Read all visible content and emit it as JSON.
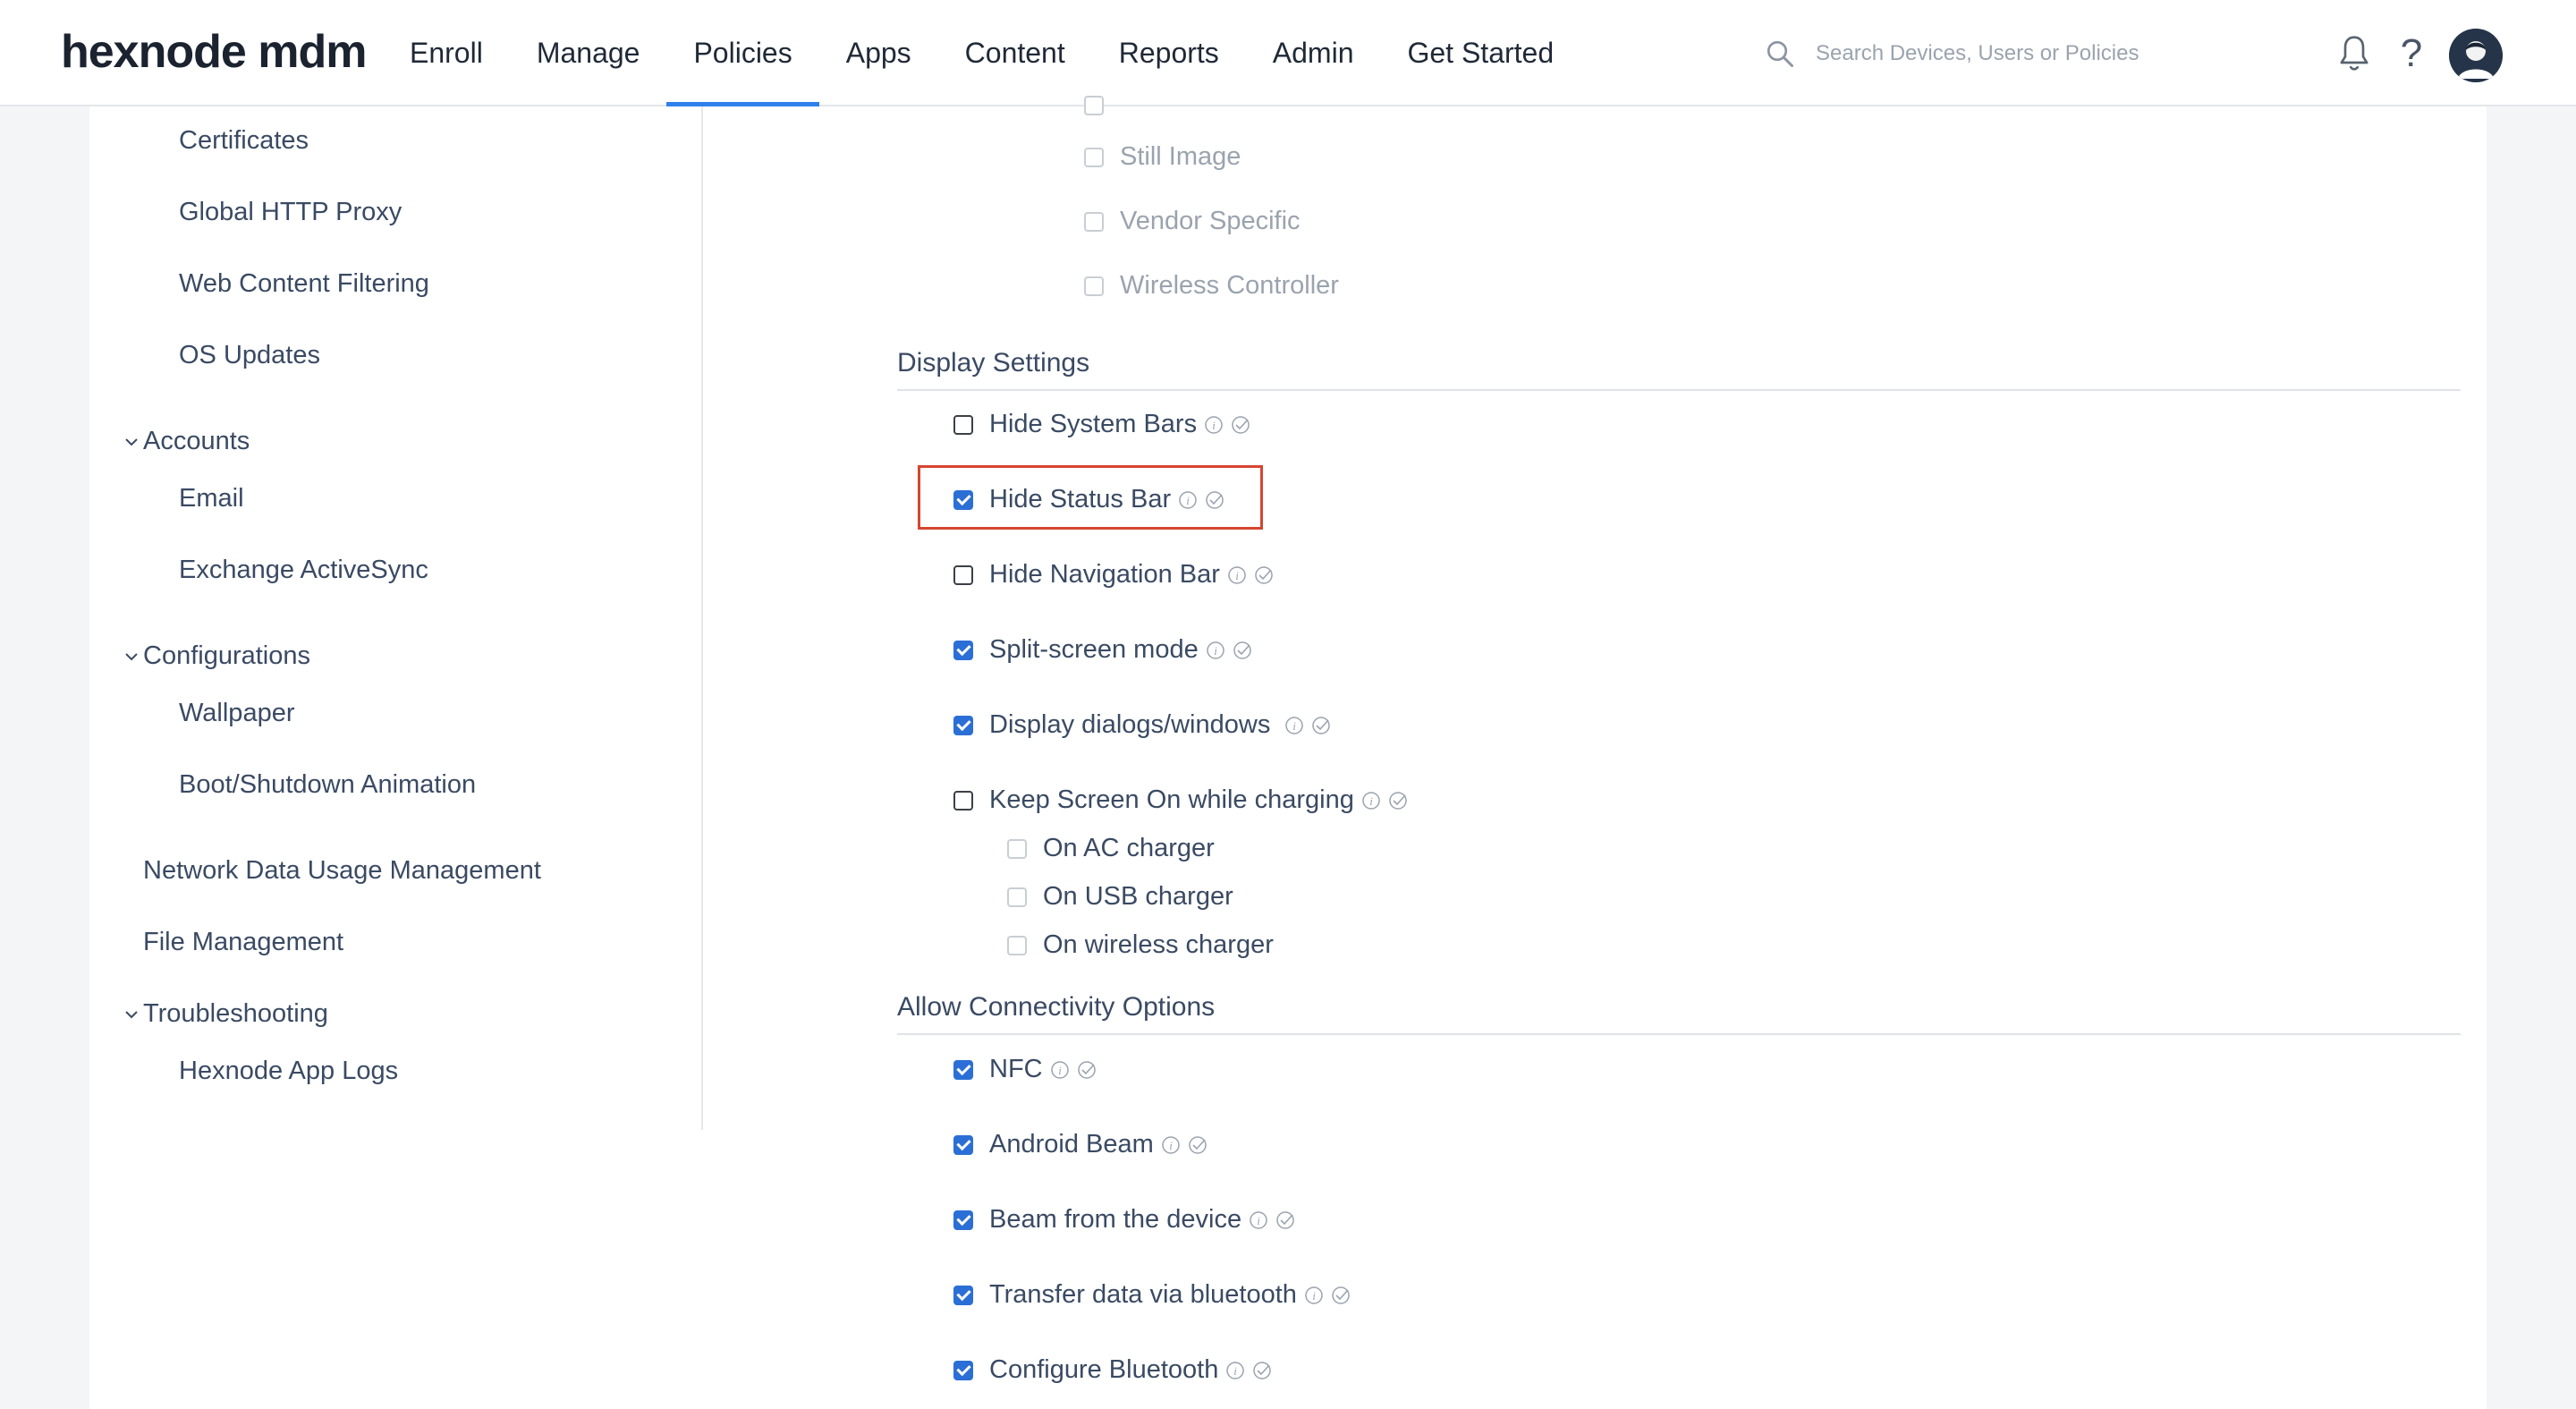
{
  "brand": {
    "logo_text": "hexnode mdm"
  },
  "nav": {
    "items": [
      "Enroll",
      "Manage",
      "Policies",
      "Apps",
      "Content",
      "Reports",
      "Admin",
      "Get Started"
    ],
    "active": "Policies"
  },
  "search": {
    "placeholder": "Search Devices, Users or Policies"
  },
  "sidebar": {
    "items": [
      {
        "label": "Certificates",
        "type": "sub"
      },
      {
        "label": "Global HTTP Proxy",
        "type": "sub"
      },
      {
        "label": "Web Content Filtering",
        "type": "sub"
      },
      {
        "label": "OS Updates",
        "type": "sub"
      },
      {
        "label": "Accounts",
        "type": "group"
      },
      {
        "label": "Email",
        "type": "sub"
      },
      {
        "label": "Exchange ActiveSync",
        "type": "sub"
      },
      {
        "label": "Configurations",
        "type": "group"
      },
      {
        "label": "Wallpaper",
        "type": "sub"
      },
      {
        "label": "Boot/Shutdown Animation",
        "type": "sub"
      },
      {
        "label": "Network Data Usage Management",
        "type": "item"
      },
      {
        "label": "File Management",
        "type": "item"
      },
      {
        "label": "Troubleshooting",
        "type": "group"
      },
      {
        "label": "Hexnode App Logs",
        "type": "sub"
      }
    ]
  },
  "usb_classes": {
    "items": [
      {
        "label": "Still Image",
        "checked": false
      },
      {
        "label": "Vendor Specific",
        "checked": false
      },
      {
        "label": "Wireless Controller",
        "checked": false
      }
    ]
  },
  "display_settings": {
    "title": "Display Settings",
    "options": [
      {
        "label": "Hide System Bars",
        "checked": false
      },
      {
        "label": "Hide Status Bar",
        "checked": true,
        "highlighted": true
      },
      {
        "label": "Hide Navigation Bar",
        "checked": false
      },
      {
        "label": "Split-screen mode",
        "checked": true
      },
      {
        "label": "Display dialogs/windows",
        "checked": true
      },
      {
        "label": "Keep Screen On while charging",
        "checked": false
      }
    ],
    "charging_suboptions": [
      {
        "label": "On AC charger",
        "checked": false
      },
      {
        "label": "On USB charger",
        "checked": false
      },
      {
        "label": "On wireless charger",
        "checked": false
      }
    ]
  },
  "connectivity": {
    "title": "Allow Connectivity Options",
    "options": [
      {
        "label": "NFC",
        "checked": true
      },
      {
        "label": "Android Beam",
        "checked": true
      },
      {
        "label": "Beam from the device",
        "checked": true
      },
      {
        "label": "Transfer data via bluetooth",
        "checked": true
      },
      {
        "label": "Configure Bluetooth",
        "checked": true
      }
    ]
  },
  "colors": {
    "accent": "#2f80ed",
    "checkbox_checked": "#2b6fd6",
    "highlight_border": "#d64530",
    "text": "#3a4a63"
  },
  "icons": [
    "search-icon",
    "bell-icon",
    "help-icon",
    "avatar",
    "info-icon",
    "check-circle-icon",
    "chevron-down-icon"
  ]
}
